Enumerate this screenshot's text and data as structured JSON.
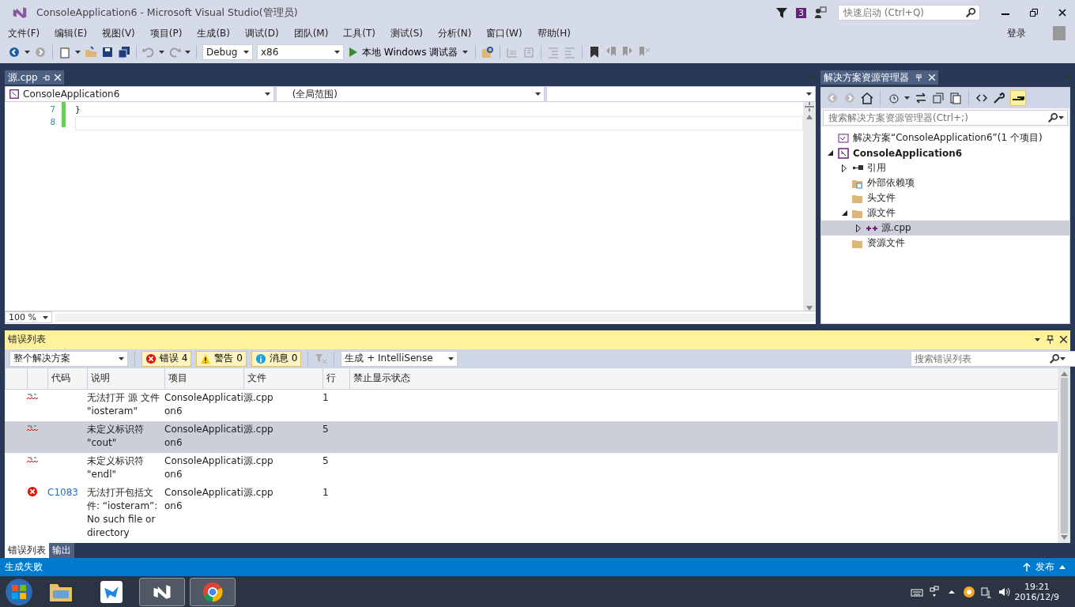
{
  "window": {
    "title": "ConsoleApplication6 - Microsoft Visual Studio(管理员)",
    "notification_count": "3",
    "quick_launch_placeholder": "快速启动 (Ctrl+Q)",
    "sign_in": "登录"
  },
  "menu": [
    "文件(F)",
    "编辑(E)",
    "视图(V)",
    "项目(P)",
    "生成(B)",
    "调试(D)",
    "团队(M)",
    "工具(T)",
    "测试(S)",
    "分析(N)",
    "窗口(W)",
    "帮助(H)"
  ],
  "toolbar": {
    "configuration": "Debug",
    "platform": "x86",
    "run": "本地 Windows 调试器"
  },
  "editor": {
    "tab": "源.cpp",
    "nav": [
      "ConsoleApplication6",
      "(全局范围)"
    ],
    "lines": [
      {
        "number": "7",
        "text": "}"
      },
      {
        "number": "8"
      }
    ],
    "zoom": "100 %"
  },
  "solution_explorer": {
    "title": "解决方案资源管理器",
    "search_placeholder": "搜索解决方案资源管理器(Ctrl+;)",
    "tree": [
      {
        "kind": "solution",
        "label": "解决方案“ConsoleApplication6”(1 个项目)",
        "selected": false
      },
      {
        "kind": "project",
        "label": "ConsoleApplication6",
        "expanded": true,
        "selected": false,
        "children": [
          {
            "kind": "references",
            "label": "引用",
            "expanded": false,
            "selected": false
          },
          {
            "kind": "external",
            "label": "外部依赖项",
            "selected": false
          },
          {
            "kind": "folder",
            "label": "头文件",
            "selected": false
          },
          {
            "kind": "folder",
            "label": "源文件",
            "expanded": true,
            "selected": false,
            "children": [
              {
                "kind": "cpp",
                "label": "源.cpp",
                "expanded": false,
                "selected": true
              }
            ]
          },
          {
            "kind": "folder",
            "label": "资源文件",
            "selected": false
          }
        ]
      }
    ]
  },
  "error_list": {
    "title": "错误列表",
    "scope": "整个解决方案",
    "filters": [
      {
        "kind": "error",
        "label": "错误 4",
        "selected": true
      },
      {
        "kind": "warning",
        "label": "警告 0",
        "selected": true
      },
      {
        "kind": "info",
        "label": "消息 0",
        "selected": true
      }
    ],
    "source": "生成 + IntelliSense",
    "search_placeholder": "搜索错误列表",
    "columns": [
      "代码",
      "说明",
      "项目",
      "文件",
      "行",
      "禁止显示状态"
    ],
    "rows": [
      {
        "kind": "intellisense",
        "description": "无法打开 源 文件 \"iosteram\"",
        "project": "ConsoleApplication6",
        "file": "源.cpp",
        "line": "1",
        "selected": false
      },
      {
        "kind": "intellisense",
        "description": "未定义标识符 \"cout\"",
        "project": "ConsoleApplication6",
        "file": "源.cpp",
        "line": "5",
        "selected": true
      },
      {
        "kind": "intellisense",
        "description": "未定义标识符 \"endl\"",
        "project": "ConsoleApplication6",
        "file": "源.cpp",
        "line": "5",
        "selected": false
      },
      {
        "kind": "error",
        "code": "C1083",
        "description": "无法打开包括文件: “iosteram”: No such file or directory",
        "project": "ConsoleApplication6",
        "file": "源.cpp",
        "line": "1",
        "selected": false
      }
    ]
  },
  "bottom_tabs": [
    {
      "label": "错误列表",
      "selected": true
    },
    {
      "label": "输出",
      "selected": false
    }
  ],
  "status_bar": {
    "text": "生成失败",
    "publish": "发布"
  },
  "taskbar": {
    "apps": [
      {
        "kind": "explorer",
        "running": false
      },
      {
        "kind": "bird",
        "running": false
      },
      {
        "kind": "vs",
        "running": true
      },
      {
        "kind": "chrome",
        "running": true
      }
    ],
    "time": "19:21",
    "date": "2016/12/9"
  }
}
